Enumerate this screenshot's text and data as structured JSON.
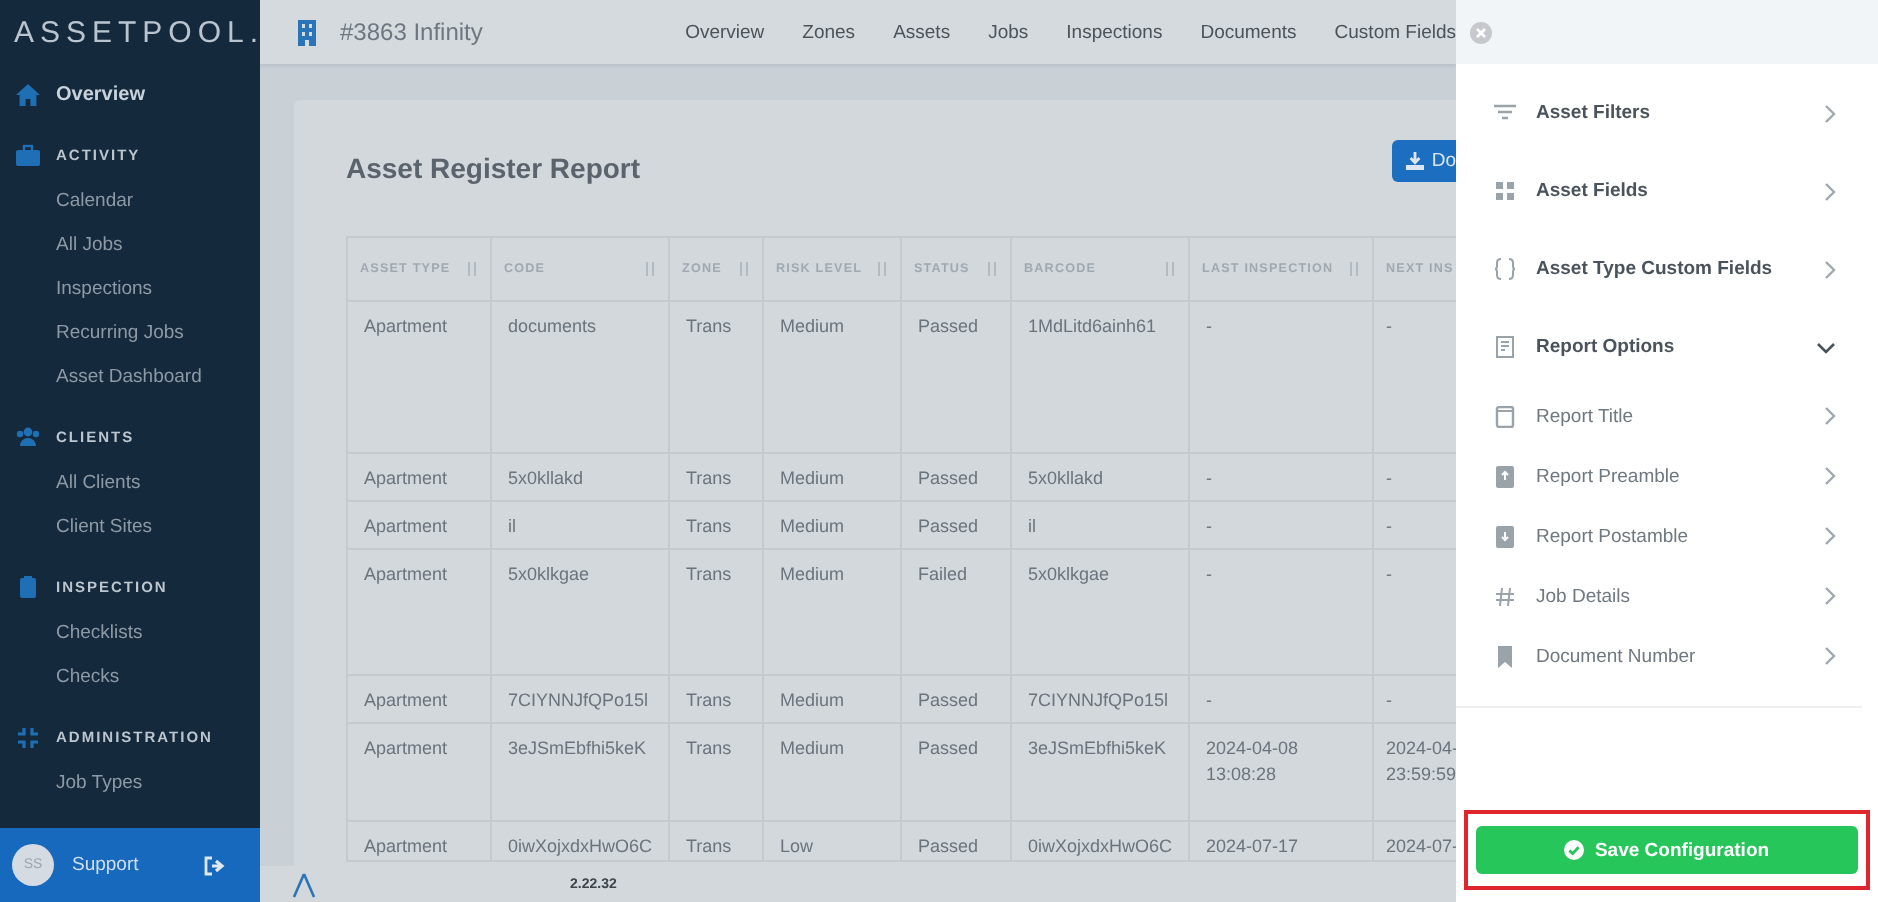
{
  "sidebar": {
    "logo": "ASSETPOOL.",
    "items": [
      {
        "label": "Overview",
        "selected": true
      }
    ],
    "sections": [
      {
        "heading": "ACTIVITY",
        "items": [
          {
            "label": "Calendar",
            "selected": false
          },
          {
            "label": "All Jobs",
            "selected": false
          },
          {
            "label": "Inspections",
            "selected": false
          },
          {
            "label": "Recurring Jobs",
            "selected": false
          },
          {
            "label": "Asset Dashboard",
            "selected": false
          }
        ]
      },
      {
        "heading": "CLIENTS",
        "items": [
          {
            "label": "All Clients",
            "selected": false
          },
          {
            "label": "Client Sites",
            "selected": false
          }
        ]
      },
      {
        "heading": "INSPECTION",
        "items": [
          {
            "label": "Checklists",
            "selected": false
          },
          {
            "label": "Checks",
            "selected": false
          }
        ]
      },
      {
        "heading": "ADMINISTRATION",
        "items": [
          {
            "label": "Job Types",
            "selected": false
          }
        ]
      }
    ],
    "user": {
      "initials": "SS",
      "name": "Support"
    }
  },
  "topbar": {
    "title": "#3863 Infinity",
    "nav": [
      "Overview",
      "Zones",
      "Assets",
      "Jobs",
      "Inspections",
      "Documents",
      "Custom Fields"
    ]
  },
  "report": {
    "title": "Asset Register Report",
    "download_button": "Do",
    "table": {
      "columns": [
        "ASSET TYPE",
        "CODE",
        "ZONE",
        "RISK LEVEL",
        "STATUS",
        "BARCODE",
        "LAST INSPECTION",
        "NEXT INS"
      ],
      "rows": [
        [
          "Apartment",
          "documents",
          "Trans",
          "Medium",
          "Passed",
          "1MdLitd6ainh61",
          "-",
          "-"
        ],
        [
          "Apartment",
          "5x0kllakd",
          "Trans",
          "Medium",
          "Passed",
          "5x0kllakd",
          "-",
          "-"
        ],
        [
          "Apartment",
          "il",
          "Trans",
          "Medium",
          "Passed",
          "il",
          "-",
          "-"
        ],
        [
          "Apartment",
          "5x0klkgae",
          "Trans",
          "Medium",
          "Failed",
          "5x0klkgae",
          "-",
          "-"
        ],
        [
          "Apartment",
          "7CIYNNJfQPo15l",
          "Trans",
          "Medium",
          "Passed",
          "7CIYNNJfQPo15l",
          "-",
          "-"
        ],
        [
          "Apartment",
          "3eJSmEbfhi5keK",
          "Trans",
          "Medium",
          "Passed",
          "3eJSmEbfhi5keK",
          "2024-04-08\n13:08:28",
          "2024-04-\n23:59:59"
        ],
        [
          "Apartment",
          "0iwXojxdxHwO6C",
          "Trans",
          "Low",
          "Passed",
          "0iwXojxdxHwO6C",
          "2024-07-17",
          "2024-07-"
        ]
      ]
    }
  },
  "footer": {
    "version": "2.22.32"
  },
  "panel": {
    "items": [
      {
        "label": "Asset Filters",
        "expanded": false
      },
      {
        "label": "Asset Fields",
        "expanded": false
      },
      {
        "label": "Asset Type Custom Fields",
        "expanded": false
      },
      {
        "label": "Report Options",
        "expanded": true,
        "children": [
          {
            "label": "Report Title"
          },
          {
            "label": "Report Preamble"
          },
          {
            "label": "Report Postamble"
          },
          {
            "label": "Job Details"
          },
          {
            "label": "Document Number"
          }
        ]
      }
    ],
    "save_button": {
      "label": "Save Configuration",
      "highlighted": true
    }
  }
}
